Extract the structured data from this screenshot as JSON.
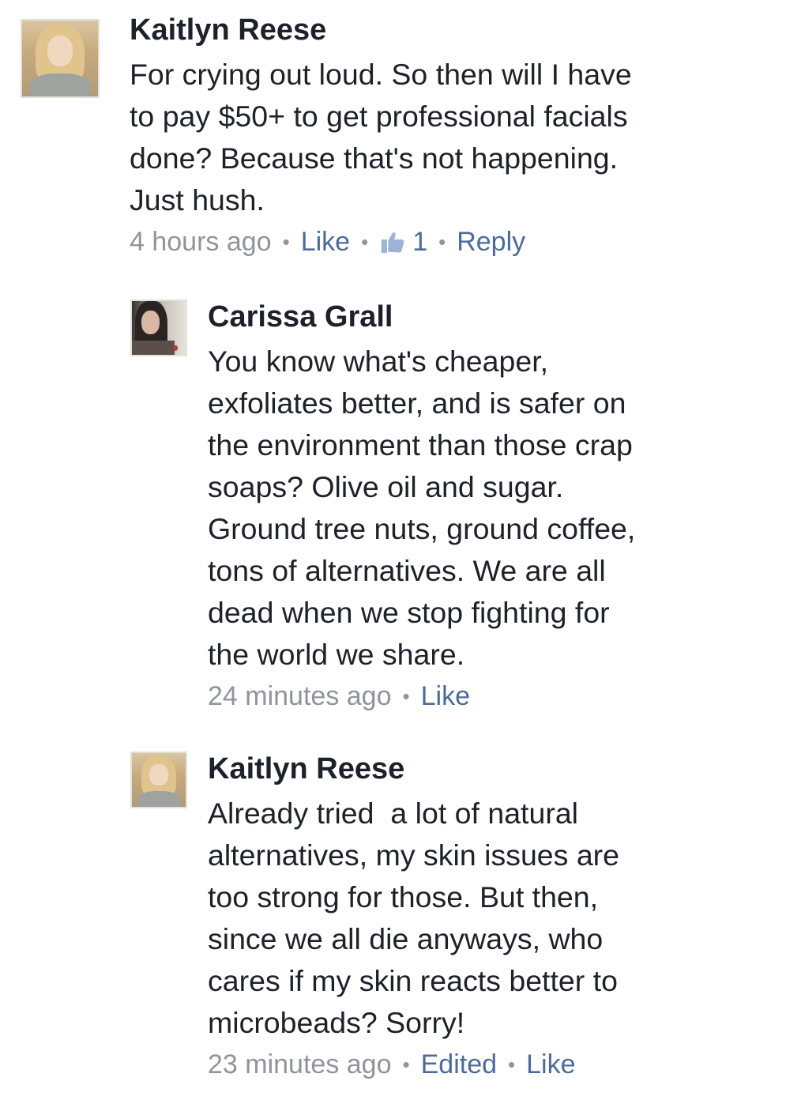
{
  "colors": {
    "text": "#1d2129",
    "meta": "#90949c",
    "link": "#4b6b9e"
  },
  "comments": [
    {
      "author": "Kaitlyn Reese",
      "text": "For crying out loud. So then will I have\nto pay $50+ to get professional facials\ndone? Because that's not happening.\nJust hush.",
      "time": "4 hours ago",
      "like_label": "Like",
      "like_count": "1",
      "reply_label": "Reply",
      "avatar_icon": "profile-photo-blonde"
    },
    {
      "author": "Carissa Grall",
      "text": "You know what's cheaper,\nexfoliates better, and is safer on\nthe environment than those crap\nsoaps? Olive oil and sugar.\nGround tree nuts, ground coffee,\ntons of alternatives. We are all\ndead when we stop fighting for\nthe world we share.",
      "time": "24 minutes ago",
      "like_label": "Like",
      "avatar_icon": "profile-photo-dark-hair"
    },
    {
      "author": "Kaitlyn Reese",
      "text": "Already tried  a lot of natural\nalternatives, my skin issues are\ntoo strong for those. But then,\nsince we all die anyways, who\ncares if my skin reacts better to\nmicrobeads? Sorry!",
      "time": "23 minutes ago",
      "edited_label": "Edited",
      "like_label": "Like",
      "avatar_icon": "profile-photo-blonde"
    }
  ]
}
